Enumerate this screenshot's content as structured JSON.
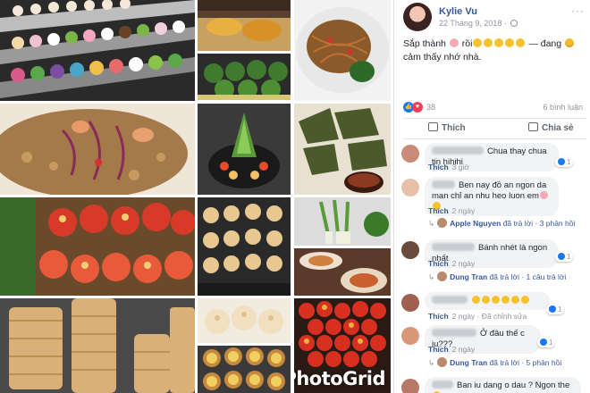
{
  "post": {
    "author": "Kylie Vu",
    "timestamp": "22 Tháng 9, 2018 ·",
    "more_label": "···",
    "text_prefix": "Sắp thành",
    "text_suffix": "rồi",
    "text_feeling_prefix": "— đang",
    "text_feeling": "cảm thấy nhớ nhà.",
    "reaction_count": "38",
    "comment_count": "6 bình luận",
    "like_label": "Thích",
    "share_label": "Chia sẻ",
    "watermark": "PhotoGrid"
  },
  "comments": [
    {
      "text": "Chua thay chua tin hihihi",
      "meta": "3 giờ",
      "like": "Thích",
      "reacts": "1"
    },
    {
      "text": "Ben nay đồ an ngon da man chỉ an nhu heo luon em",
      "meta": "2 ngày",
      "like": "Thích",
      "reacts": "",
      "reply_name": "Apple Nguyen",
      "reply_text": "đã trả lời · 3 phản hồi"
    },
    {
      "text": "Bánh nhét là ngon nhất",
      "meta": "2 ngày",
      "like": "Thích",
      "reacts": "1",
      "reply_name": "Dung Tran",
      "reply_text": "đã trả lời · 1 câu trả lời"
    },
    {
      "text": "",
      "meta": "2 ngày · Đã chỉnh sửa",
      "like": "Thích",
      "reacts": "1"
    },
    {
      "text": "Ở đâu thế c iu???",
      "meta": "2 ngày",
      "like": "Thích",
      "reacts": "1",
      "reply_name": "Dung Tran",
      "reply_text": "đã trả lời · 5 phản hồi"
    },
    {
      "text": "Ban iu dang o dau ? Ngon the",
      "meta": "",
      "like": "",
      "reacts": ""
    }
  ],
  "colors": {
    "link": "#385898",
    "muted": "#90949c",
    "bubble": "#f2f3f5",
    "like_blue": "#1877f2",
    "love_red": "#f33e58"
  },
  "icons": [
    "globe-icon",
    "like-reaction-icon",
    "love-reaction-icon",
    "thumbs-up-icon",
    "share-icon",
    "reply-arrow-icon"
  ]
}
